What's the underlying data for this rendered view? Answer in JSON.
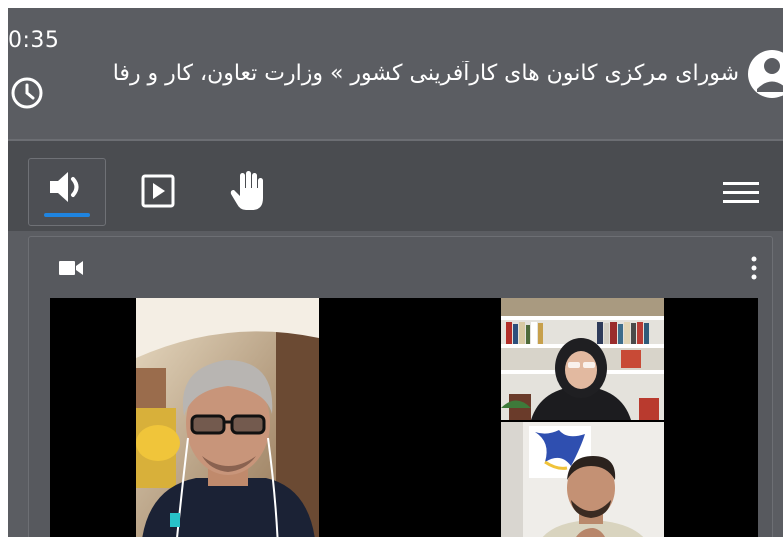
{
  "header": {
    "timer": "0:35",
    "meeting_title": "شورای مرکزی کانون های کارآفرینی کشور » وزارت تعاون، کار و رفا"
  },
  "icons": {
    "clock": "clock-icon",
    "avatar": "user-avatar-icon",
    "audio": "speaker-icon",
    "play": "play-icon",
    "hand": "raise-hand-icon",
    "menu": "hamburger-menu-icon",
    "camera": "video-camera-icon",
    "more": "more-vertical-icon"
  },
  "toolbar": {
    "active_tab": "audio",
    "accent_color": "#1f84e0"
  },
  "video_panel": {
    "participants": [
      {
        "position": "main",
        "description": "man with glasses and earphones"
      },
      {
        "position": "top-right",
        "description": "woman in headscarf, bookshelf background"
      },
      {
        "position": "bottom-right",
        "description": "man with beard, painting background"
      }
    ]
  },
  "colors": {
    "header_bg": "#5b5d62",
    "toolbar_bg": "#4a4c50",
    "panel_bg": "#57595e",
    "video_bg": "#000000"
  }
}
